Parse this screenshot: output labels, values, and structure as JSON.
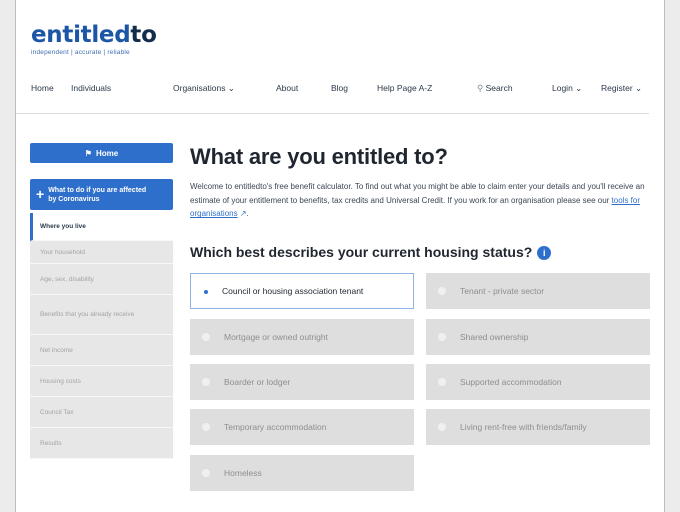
{
  "brand": {
    "logo_main": "entitled",
    "logo_suffix": "to",
    "tagline": "independent | accurate | reliable"
  },
  "nav": {
    "items": [
      "Home",
      "Individuals",
      "Organisations ⌄",
      "About",
      "Blog",
      "Help Page A-Z",
      "Search",
      "Login ⌄",
      "Register ⌄"
    ]
  },
  "sidebar": {
    "home_label": "Home",
    "covid_label": "What to do if you are affected by Coronavirus",
    "steps": [
      "Where you live",
      "Your household",
      "Age, sex, disability",
      "Benefits that you already receive",
      "Net income",
      "Housing costs",
      "Council Tax",
      "Results"
    ]
  },
  "main": {
    "title": "What are you entitled to?",
    "intro_text": "Welcome to entitledto's free benefit calculator. To find out what you might be able to claim enter your details and you'll receive an estimate of your entitlement to benefits, tax credits and Universal Credit. If you work for an organisation please see our ",
    "intro_link": "tools for organisations",
    "intro_end": ".",
    "question": "Which best describes your current housing status?"
  },
  "housing_options": [
    "Council or housing association tenant",
    "Tenant - private sector",
    "Mortgage or owned outright",
    "Shared ownership",
    "Boarder or lodger",
    "Supported accommodation",
    "Temporary accommodation",
    "Living rent-free with friends/family",
    "Homeless"
  ],
  "selected_option": "Council or housing association tenant",
  "colors": {
    "brand_blue": "#2f6fcc",
    "logo_blue": "#1d56a6",
    "logo_dark": "#122c4a"
  }
}
